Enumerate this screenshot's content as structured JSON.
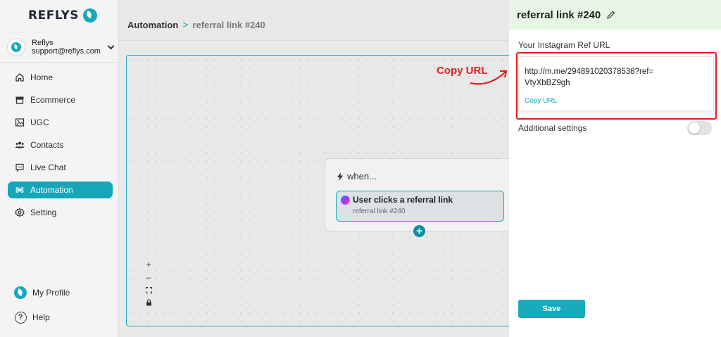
{
  "sidebar": {
    "logo_text": "REFLYS",
    "account": {
      "name": "Reflys",
      "email": "support@reflys.com"
    },
    "items": [
      {
        "label": "Home",
        "icon": "home-icon"
      },
      {
        "label": "Ecommerce",
        "icon": "store-icon"
      },
      {
        "label": "UGC",
        "icon": "image-icon"
      },
      {
        "label": "Contacts",
        "icon": "users-icon"
      },
      {
        "label": "Live Chat",
        "icon": "chat-icon"
      },
      {
        "label": "Automation",
        "icon": "automation-icon",
        "active": true
      },
      {
        "label": "Setting",
        "icon": "gear-icon"
      }
    ],
    "profile_label": "My Profile",
    "help_label": "Help",
    "accent_color": "#17a6b8"
  },
  "header": {
    "breadcrumb_root": "Automation",
    "breadcrumb_separator": ">",
    "breadcrumb_current": "referral link #240"
  },
  "canvas": {
    "zoom_in": "+",
    "zoom_out": "–",
    "trigger": {
      "title": "when...",
      "card_title": "User clicks a referral link",
      "card_subtitle": "referral link #240"
    },
    "add_button": "+"
  },
  "panel": {
    "title": "referral link #240",
    "url_label": "Your Instagram Ref URL",
    "url_value": "http://m.me/294891020378538?ref=VtyXbBZ9gh",
    "copy_label": "Copy URL",
    "additional_settings_label": "Additional settings",
    "additional_settings_enabled": false,
    "save_label": "Save",
    "header_color": "#e7f6e4"
  },
  "annotation": {
    "text": "Copy URL",
    "color": "#e02020"
  }
}
